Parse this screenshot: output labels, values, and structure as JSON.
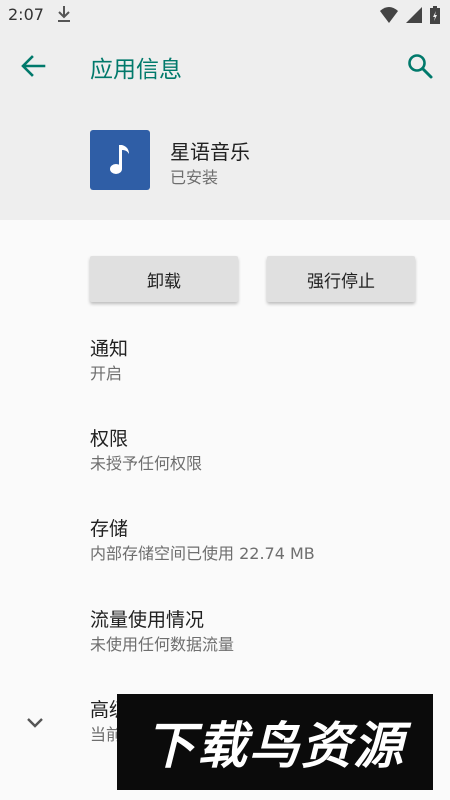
{
  "status_bar": {
    "time": "2:07",
    "icons": [
      "download-icon",
      "wifi-icon",
      "signal-icon",
      "battery-icon"
    ]
  },
  "app_bar": {
    "title": "应用信息",
    "back_icon": "arrow-left-icon",
    "search_icon": "search-icon",
    "accent_color": "#00796b"
  },
  "app": {
    "name": "星语音乐",
    "status": "已安装",
    "icon": "music-note-icon",
    "icon_color": "#2f5ea6"
  },
  "buttons": {
    "uninstall": "卸载",
    "force_stop": "强行停止"
  },
  "prefs": [
    {
      "title": "通知",
      "summary": "开启"
    },
    {
      "title": "权限",
      "summary": "未授予任何权限"
    },
    {
      "title": "存储",
      "summary": "内部存储空间已使用 22.74 MB"
    },
    {
      "title": "流量使用情况",
      "summary": "未使用任何数据流量"
    },
    {
      "title": "高级",
      "summary": "当前..."
    }
  ],
  "watermark": {
    "text": "下载鸟资源"
  }
}
